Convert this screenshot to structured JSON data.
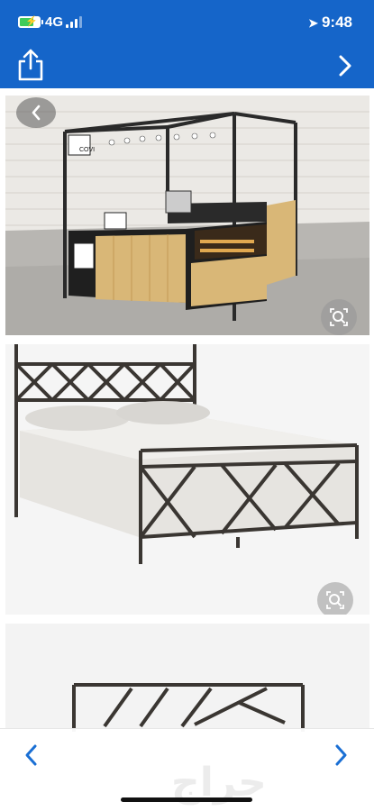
{
  "status_bar": {
    "carrier": "4G",
    "time": "9:48",
    "battery_level": 0.72
  },
  "toolbar": {
    "share_icon": "share-icon",
    "next_icon": "chevron-right-icon"
  },
  "gallery": {
    "images": [
      {
        "description_icon": "kiosk-image",
        "sign_text": "COVI",
        "action_icon": "zoom-icon"
      },
      {
        "description_icon": "bed-image",
        "action_icon": "zoom-icon"
      },
      {
        "description_icon": "headboard-image"
      }
    ],
    "back_icon": "chevron-left-icon"
  },
  "bottom_bar": {
    "watermark": "حراج",
    "prev_icon": "chevron-left-icon",
    "next_icon": "chevron-right-icon"
  },
  "colors": {
    "header": "#1565c9",
    "accent": "#1a6fd4"
  }
}
